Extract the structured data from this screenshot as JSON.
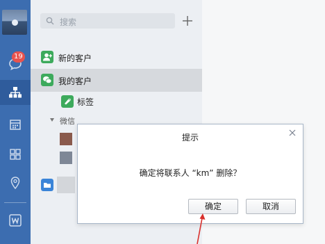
{
  "sidebar": {
    "unread_badge": "19",
    "icons": [
      "chat-icon",
      "org-chart-icon",
      "calendar-icon",
      "apps-grid-icon",
      "location-icon",
      "word-doc-icon"
    ],
    "word_label": "W"
  },
  "search": {
    "placeholder": "搜索"
  },
  "contacts": {
    "items": [
      {
        "label": "新的客户",
        "icon": "add-contact-icon",
        "color": "#3daa5c"
      },
      {
        "label": "我的客户",
        "icon": "wechat-icon",
        "color": "#3daa5c",
        "selected": true
      },
      {
        "label": "标签",
        "icon": "tag-icon",
        "color": "#3daa5c"
      }
    ],
    "group_label": "微信"
  },
  "dialog": {
    "title": "提示",
    "message": "确定将联系人 “km” 删除？",
    "ok_label": "确定",
    "cancel_label": "取消"
  },
  "colors": {
    "rail": "#3c6db0",
    "panel": "#eceff3",
    "accent_green": "#3daa5c",
    "badge": "#e8534e",
    "annotation_arrow": "#d9302c"
  }
}
